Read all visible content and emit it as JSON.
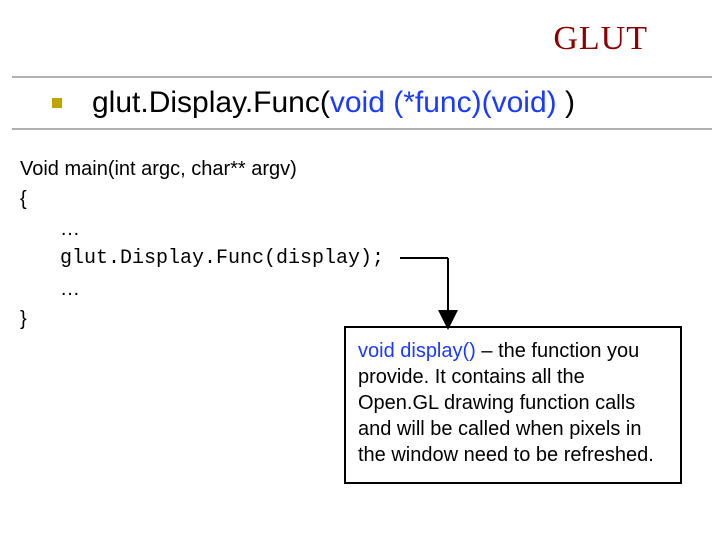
{
  "header": {
    "title": "GLUT"
  },
  "subtitle": {
    "prefix": "glut.Display.Func(",
    "args": "void (*func)(void) ",
    "suffix": ")"
  },
  "code": {
    "l1": "Void main(int argc, char** argv)",
    "l2": "{",
    "l3": "…",
    "l4": "glut.Display.Func(display);",
    "l5": "…",
    "l6": "}"
  },
  "callout": {
    "lead": "void display()",
    "rest": " – the function you provide.  It contains all the Open.GL drawing function calls and will be called when pixels in the window need to be refreshed."
  }
}
